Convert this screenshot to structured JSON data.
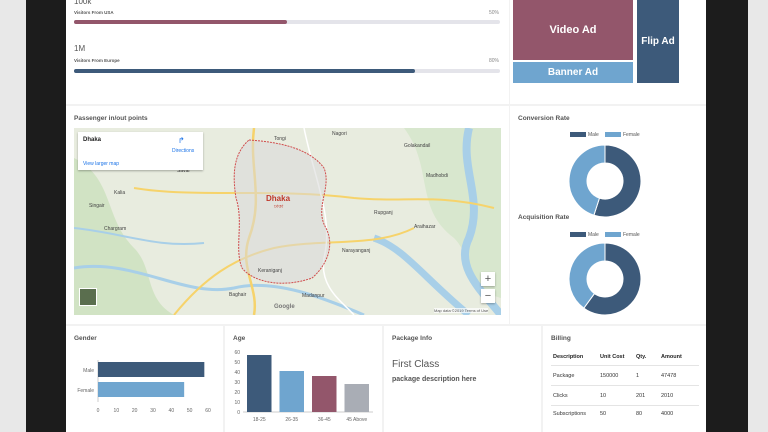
{
  "visitors": {
    "usa": {
      "value": "100k",
      "label": "Visitors From USA",
      "percent_text": "50%",
      "fraction": 0.5,
      "color": "#93566b"
    },
    "europe": {
      "value": "1M",
      "label": "Visitors From Europe",
      "percent_text": "80%",
      "fraction": 0.8,
      "color": "#3d5a7a"
    }
  },
  "ads": {
    "video": "Video Ad",
    "banner": "Banner Ad",
    "flip": "Flip Ad",
    "colors": {
      "video": "#93566b",
      "banner": "#6fa5cf",
      "flip": "#3d5a7a"
    }
  },
  "map_panel": {
    "title": "Passenger in/out points",
    "card_place": "Dhaka",
    "card_link": "View larger map",
    "card_directions": "Directions",
    "city_label": "Dhaka",
    "city_label_local": "ঢাকা",
    "place_labels": [
      "Tongi",
      "Savar",
      "Nagori",
      "Madhobdi",
      "Narayanganj",
      "Keraniganj",
      "Chargram",
      "Baghair",
      "Madanpur",
      "Kalia",
      "Rupganj",
      "Araihazar",
      "Golakandail",
      "Singair"
    ],
    "zoom_in": "+",
    "zoom_out": "−",
    "footer": "Map data ©2019   Terms of Use",
    "google": "Google"
  },
  "conversion": {
    "title": "Conversion Rate",
    "legend": [
      "Male",
      "Female"
    ],
    "colors": [
      "#3d5a7a",
      "#6fa5cf"
    ],
    "chart_data": {
      "type": "pie",
      "labels": [
        "Male",
        "Female"
      ],
      "values": [
        55,
        45
      ]
    }
  },
  "acquisition": {
    "title": "Acquisition Rate",
    "legend": [
      "Male",
      "Female"
    ],
    "colors": [
      "#3d5a7a",
      "#6fa5cf"
    ],
    "chart_data": {
      "type": "pie",
      "labels": [
        "Male",
        "Female"
      ],
      "values": [
        60,
        40
      ]
    }
  },
  "gender": {
    "title": "Gender",
    "chart_data": {
      "type": "bar",
      "categories": [
        "Male",
        "Female"
      ],
      "values": [
        58,
        47
      ],
      "xlim": [
        0,
        60
      ],
      "ticks": [
        "0",
        "10",
        "20",
        "30",
        "40",
        "50",
        "60"
      ]
    },
    "colors": [
      "#3d5a7a",
      "#6fa5cf"
    ]
  },
  "age": {
    "title": "Age",
    "chart_data": {
      "type": "bar",
      "categories": [
        "18-25",
        "26-35",
        "36-45",
        "45 Above"
      ],
      "values": [
        57,
        41,
        36,
        28
      ],
      "ylim": [
        0,
        60
      ],
      "ticks": [
        "0",
        "10",
        "20",
        "30",
        "40",
        "50",
        "60"
      ]
    },
    "colors": [
      "#3d5a7a",
      "#6fa5cf",
      "#93566b",
      "#a9adb5"
    ]
  },
  "package": {
    "title": "Package Info",
    "name": "First Class",
    "description": "package description here"
  },
  "billing": {
    "title": "Billing",
    "headers": [
      "Description",
      "Unit Cost",
      "Qty.",
      "Amount"
    ],
    "rows": [
      [
        "Package",
        "150000",
        "1",
        "47478"
      ],
      [
        "Clicks",
        "10",
        "201",
        "2010"
      ],
      [
        "Subscriptions",
        "50",
        "80",
        "4000"
      ]
    ]
  }
}
